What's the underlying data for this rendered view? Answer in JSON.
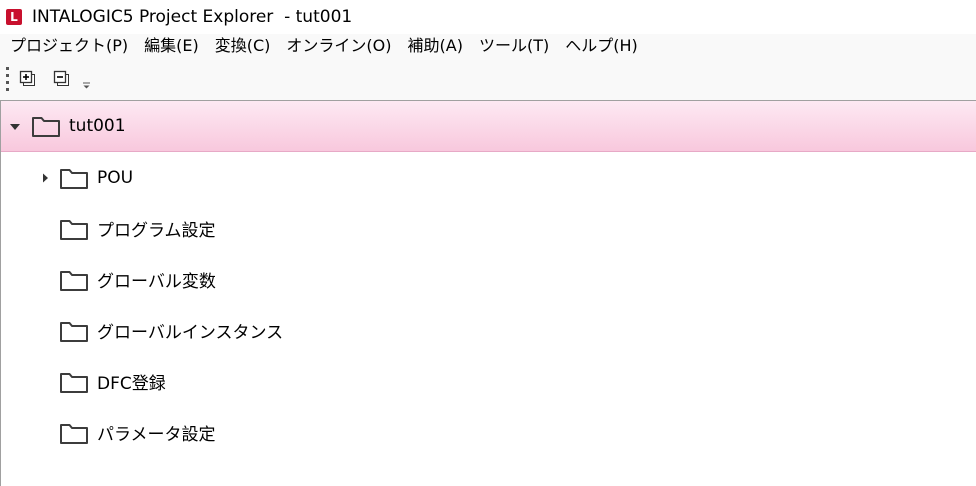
{
  "window": {
    "title": "INTALOGIC5 Project Explorer  - tut001",
    "logo_letter": "L"
  },
  "menubar": {
    "items": [
      "プロジェクト(P)",
      "編集(E)",
      "変換(C)",
      "オンライン(O)",
      "補助(A)",
      "ツール(T)",
      "ヘルプ(H)"
    ]
  },
  "toolbar": {
    "buttons": [
      "expand-all-icon",
      "collapse-all-icon"
    ],
    "overflow": "overflow-chevron-icon"
  },
  "tree": {
    "root": {
      "label": "tut001",
      "expanded": true,
      "selected": true
    },
    "children": [
      {
        "label": "POU",
        "has_children": true,
        "expanded": false
      },
      {
        "label": "プログラム設定",
        "has_children": false
      },
      {
        "label": "グローバル変数",
        "has_children": false
      },
      {
        "label": "グローバルインスタンス",
        "has_children": false
      },
      {
        "label": "DFC登録",
        "has_children": false
      },
      {
        "label": "パラメータ設定",
        "has_children": false
      }
    ]
  },
  "colors": {
    "selection_top": "#fde9f3",
    "selection_bottom": "#f8c8dd",
    "logo_red": "#c8102e"
  }
}
